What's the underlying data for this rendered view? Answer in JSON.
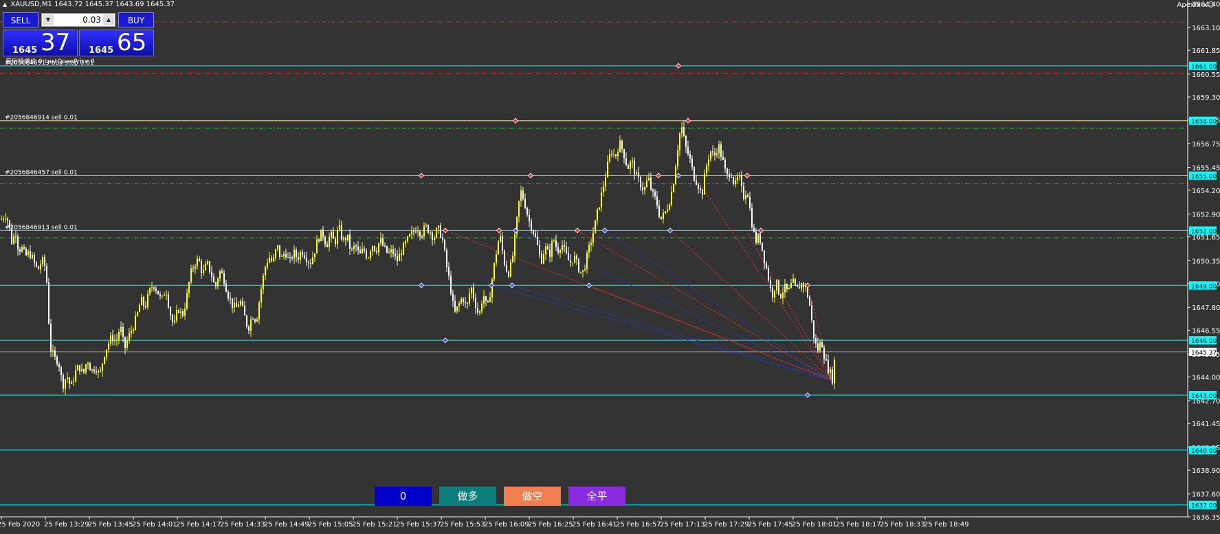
{
  "header": {
    "symbol": "XAUUSD,M1",
    "ohlc": "1643.72 1645.37 1643.69 1645.37",
    "brand": "Apexfx-x☺"
  },
  "trade_panel": {
    "sell_label": "SELL",
    "buy_label": "BUY",
    "lot_value": "0.03",
    "bid_big": "1645",
    "bid_pips": "37",
    "ask_big": "1645",
    "ask_pips": "65",
    "info_text": "最后挂单价 0 LastOpenPrice 0"
  },
  "bottom_buttons": [
    {
      "label": "0",
      "color": "#0000c8"
    },
    {
      "label": "做多",
      "color": "#0b7d7d"
    },
    {
      "label": "做空",
      "color": "#f07f4f"
    },
    {
      "label": "全平",
      "color": "#8a2be2"
    }
  ],
  "chart_data": {
    "type": "candlestick",
    "symbol": "XAUUSD",
    "timeframe": "M1",
    "ylim": [
      1636.35,
      1664.3
    ],
    "y_ticks": [
      "1664.40",
      "1663.10",
      "1661.85",
      "1660.55",
      "1659.30",
      "1658.05",
      "1656.75",
      "1655.45",
      "1654.20",
      "1652.90",
      "1651.65",
      "1650.35",
      "1649.10",
      "1647.80",
      "1646.55",
      "1645.25",
      "1644.00",
      "1642.70",
      "1641.45",
      "1640.15",
      "1638.90",
      "1637.60",
      "1636.35"
    ],
    "x_ticks": [
      "25 Feb 2020",
      "25 Feb 13:29",
      "25 Feb 13:45",
      "25 Feb 14:01",
      "25 Feb 14:17",
      "25 Feb 14:33",
      "25 Feb 14:49",
      "25 Feb 15:05",
      "25 Feb 15:21",
      "25 Feb 15:37",
      "25 Feb 15:53",
      "25 Feb 16:09",
      "25 Feb 16:25",
      "25 Feb 16:41",
      "25 Feb 16:57",
      "25 Feb 17:13",
      "25 Feb 17:29",
      "25 Feb 17:45",
      "25 Feb 18:01",
      "25 Feb 18:17",
      "25 Feb 18:33",
      "25 Feb 18:49"
    ],
    "current_price": "1645.37",
    "horizontal_levels": [
      {
        "price": 1661.0,
        "label": "1661.00",
        "color": "#00ffff"
      },
      {
        "price": 1658.0,
        "label": "1658.00",
        "color": "#ffff00"
      },
      {
        "price": 1655.0,
        "label": "1655.00",
        "color": "#00ffff"
      },
      {
        "price": 1652.0,
        "label": "1652.00",
        "color": "#00ffff"
      },
      {
        "price": 1649.0,
        "label": "1649.00",
        "color": "#00ffff"
      },
      {
        "price": 1646.0,
        "label": "1646.00",
        "color": "#00ffff"
      },
      {
        "price": 1643.0,
        "label": "1643.00",
        "color": "#00ffff"
      },
      {
        "price": 1640.0,
        "label": "1640.00",
        "color": "#00ffff"
      },
      {
        "price": 1637.0,
        "label": "1637.00",
        "color": "#00ffff"
      }
    ],
    "dashed_levels": [
      {
        "price": 1663.4,
        "color": "#c83232"
      },
      {
        "price": 1660.6,
        "color": "#c83232"
      },
      {
        "price": 1657.6,
        "color": "#32b432"
      },
      {
        "price": 1654.55,
        "color": "#32b432"
      },
      {
        "price": 1651.6,
        "color": "#32b432"
      }
    ],
    "order_labels": [
      {
        "price": 1661.0,
        "text": "#2056846913 buy stop 0.01"
      },
      {
        "price": 1658.0,
        "text": "#2056846914 sell 0.01"
      },
      {
        "price": 1655.0,
        "text": "#2056846457 sell 0.01"
      },
      {
        "price": 1652.0,
        "text": "#2056846913 sell 0.01"
      }
    ],
    "close_path": [
      [
        0,
        1652.6
      ],
      [
        8,
        1652.9
      ],
      [
        12,
        1652.3
      ],
      [
        16,
        1651.4
      ],
      [
        22,
        1651.9
      ],
      [
        26,
        1650.9
      ],
      [
        30,
        1651.1
      ],
      [
        36,
        1650.6
      ],
      [
        42,
        1650.8
      ],
      [
        48,
        1650.3
      ],
      [
        54,
        1649.8
      ],
      [
        60,
        1650.4
      ],
      [
        66,
        1649.9
      ],
      [
        72,
        1645.6
      ],
      [
        78,
        1645.0
      ],
      [
        84,
        1644.9
      ],
      [
        90,
        1643.5
      ],
      [
        96,
        1644.1
      ],
      [
        102,
        1643.4
      ],
      [
        108,
        1644.2
      ],
      [
        114,
        1644.6
      ],
      [
        120,
        1644.1
      ],
      [
        126,
        1645.0
      ],
      [
        132,
        1644.3
      ],
      [
        138,
        1644.6
      ],
      [
        144,
        1644.0
      ],
      [
        150,
        1645.2
      ],
      [
        156,
        1645.8
      ],
      [
        162,
        1646.2
      ],
      [
        168,
        1645.9
      ],
      [
        174,
        1646.8
      ],
      [
        180,
        1645.5
      ],
      [
        186,
        1646.2
      ],
      [
        192,
        1646.7
      ],
      [
        198,
        1647.3
      ],
      [
        204,
        1648.2
      ],
      [
        210,
        1647.8
      ],
      [
        216,
        1648.6
      ],
      [
        222,
        1649.1
      ],
      [
        228,
        1648.7
      ],
      [
        234,
        1648.1
      ],
      [
        240,
        1648.9
      ],
      [
        246,
        1647.6
      ],
      [
        252,
        1646.7
      ],
      [
        258,
        1647.8
      ],
      [
        264,
        1647.3
      ],
      [
        270,
        1648.2
      ],
      [
        276,
        1649.6
      ],
      [
        282,
        1650.2
      ],
      [
        288,
        1650.4
      ],
      [
        294,
        1649.6
      ],
      [
        300,
        1650.2
      ],
      [
        306,
        1649.7
      ],
      [
        312,
        1648.8
      ],
      [
        318,
        1649.8
      ],
      [
        324,
        1649.5
      ],
      [
        330,
        1648.6
      ],
      [
        336,
        1648.0
      ],
      [
        342,
        1647.7
      ],
      [
        348,
        1648.2
      ],
      [
        354,
        1647.4
      ],
      [
        360,
        1646.6
      ],
      [
        366,
        1647.4
      ],
      [
        372,
        1647.1
      ],
      [
        378,
        1648.6
      ],
      [
        384,
        1649.9
      ],
      [
        390,
        1650.6
      ],
      [
        396,
        1650.2
      ],
      [
        402,
        1651.2
      ],
      [
        408,
        1650.4
      ],
      [
        414,
        1650.9
      ],
      [
        420,
        1650.2
      ],
      [
        426,
        1650.8
      ],
      [
        432,
        1650.5
      ],
      [
        438,
        1650.9
      ],
      [
        444,
        1650.6
      ],
      [
        450,
        1650.2
      ],
      [
        456,
        1650.8
      ],
      [
        462,
        1651.6
      ],
      [
        468,
        1651.9
      ],
      [
        474,
        1651.2
      ],
      [
        480,
        1651.8
      ],
      [
        486,
        1651.3
      ],
      [
        492,
        1652.2
      ],
      [
        498,
        1651.4
      ],
      [
        504,
        1651.7
      ],
      [
        510,
        1650.8
      ],
      [
        516,
        1651.2
      ],
      [
        522,
        1650.6
      ],
      [
        528,
        1651.0
      ],
      [
        534,
        1650.5
      ],
      [
        540,
        1651.3
      ],
      [
        546,
        1650.9
      ],
      [
        552,
        1651.5
      ],
      [
        558,
        1651.0
      ],
      [
        564,
        1650.7
      ],
      [
        570,
        1650.9
      ],
      [
        576,
        1650.3
      ],
      [
        582,
        1650.8
      ],
      [
        588,
        1651.2
      ],
      [
        594,
        1651.6
      ],
      [
        600,
        1651.9
      ],
      [
        606,
        1652.2
      ],
      [
        612,
        1651.8
      ],
      [
        618,
        1652.2
      ],
      [
        624,
        1652.0
      ],
      [
        630,
        1651.6
      ],
      [
        636,
        1652.1
      ],
      [
        642,
        1651.7
      ],
      [
        648,
        1650.2
      ],
      [
        654,
        1649.0
      ],
      [
        660,
        1647.4
      ],
      [
        666,
        1647.9
      ],
      [
        672,
        1648.4
      ],
      [
        678,
        1647.7
      ],
      [
        684,
        1649.0
      ],
      [
        690,
        1648.1
      ],
      [
        696,
        1647.3
      ],
      [
        702,
        1648.6
      ],
      [
        708,
        1647.6
      ],
      [
        714,
        1649.1
      ],
      [
        720,
        1650.6
      ],
      [
        726,
        1651.8
      ],
      [
        732,
        1650.4
      ],
      [
        738,
        1649.6
      ],
      [
        744,
        1650.3
      ],
      [
        750,
        1652.2
      ],
      [
        756,
        1654.2
      ],
      [
        762,
        1653.6
      ],
      [
        768,
        1652.6
      ],
      [
        774,
        1652.1
      ],
      [
        780,
        1651.3
      ],
      [
        786,
        1650.3
      ],
      [
        792,
        1651.1
      ],
      [
        798,
        1650.6
      ],
      [
        804,
        1651.6
      ],
      [
        810,
        1650.9
      ],
      [
        816,
        1651.3
      ],
      [
        822,
        1650.7
      ],
      [
        828,
        1650.2
      ],
      [
        834,
        1650.6
      ],
      [
        840,
        1650.0
      ],
      [
        846,
        1649.6
      ],
      [
        852,
        1650.4
      ],
      [
        858,
        1651.3
      ],
      [
        864,
        1652.2
      ],
      [
        870,
        1653.3
      ],
      [
        876,
        1654.3
      ],
      [
        882,
        1655.4
      ],
      [
        888,
        1656.4
      ],
      [
        894,
        1656.0
      ],
      [
        900,
        1656.8
      ],
      [
        906,
        1656.3
      ],
      [
        912,
        1655.4
      ],
      [
        918,
        1655.8
      ],
      [
        924,
        1655.0
      ],
      [
        930,
        1654.6
      ],
      [
        936,
        1654.2
      ],
      [
        942,
        1654.9
      ],
      [
        948,
        1654.0
      ],
      [
        954,
        1653.6
      ],
      [
        960,
        1652.6
      ],
      [
        966,
        1652.9
      ],
      [
        972,
        1653.5
      ],
      [
        978,
        1654.4
      ],
      [
        984,
        1656.3
      ],
      [
        990,
        1657.8
      ],
      [
        996,
        1656.6
      ],
      [
        1002,
        1656.0
      ],
      [
        1008,
        1655.0
      ],
      [
        1014,
        1654.6
      ],
      [
        1020,
        1653.9
      ],
      [
        1026,
        1655.4
      ],
      [
        1032,
        1656.4
      ],
      [
        1038,
        1656.0
      ],
      [
        1044,
        1656.7
      ],
      [
        1050,
        1655.9
      ],
      [
        1056,
        1654.9
      ],
      [
        1062,
        1655.3
      ],
      [
        1068,
        1654.4
      ],
      [
        1074,
        1655.0
      ],
      [
        1080,
        1653.8
      ],
      [
        1086,
        1654.3
      ],
      [
        1092,
        1652.6
      ],
      [
        1098,
        1651.4
      ],
      [
        1104,
        1651.7
      ],
      [
        1110,
        1650.6
      ],
      [
        1116,
        1649.6
      ],
      [
        1122,
        1648.4
      ],
      [
        1128,
        1649.2
      ],
      [
        1134,
        1648.4
      ],
      [
        1140,
        1648.9
      ],
      [
        1146,
        1648.6
      ],
      [
        1152,
        1649.2
      ],
      [
        1158,
        1648.7
      ],
      [
        1164,
        1649.1
      ],
      [
        1170,
        1649.0
      ],
      [
        1176,
        1648.2
      ],
      [
        1182,
        1646.4
      ],
      [
        1188,
        1645.4
      ],
      [
        1194,
        1646.0
      ],
      [
        1200,
        1644.8
      ],
      [
        1206,
        1644.3
      ],
      [
        1211,
        1643.8
      ],
      [
        1214,
        1645.37
      ]
    ],
    "line_segments": [
      {
        "x1": 648,
        "y1": 1652.0,
        "x2": 1211,
        "y2": 1643.8,
        "color": "#c83232"
      },
      {
        "x1": 750,
        "y1": 1652.0,
        "x2": 1211,
        "y2": 1643.8,
        "color": "#2040c8"
      },
      {
        "x1": 840,
        "y1": 1652.0,
        "x2": 1211,
        "y2": 1643.8,
        "color": "#c83232"
      },
      {
        "x1": 880,
        "y1": 1652.0,
        "x2": 1211,
        "y2": 1643.8,
        "color": "#2040c8"
      },
      {
        "x1": 975,
        "y1": 1652.0,
        "x2": 1211,
        "y2": 1643.8,
        "color": "#c83232"
      },
      {
        "x1": 1010,
        "y1": 1655.0,
        "x2": 1211,
        "y2": 1643.8,
        "color": "#c83232"
      },
      {
        "x1": 1085,
        "y1": 1652.0,
        "x2": 1211,
        "y2": 1643.8,
        "color": "#c83232"
      },
      {
        "x1": 1175,
        "y1": 1649.0,
        "x2": 1211,
        "y2": 1643.8,
        "color": "#c83232"
      },
      {
        "x1": 715,
        "y1": 1649.0,
        "x2": 1211,
        "y2": 1643.8,
        "color": "#2040c8"
      },
      {
        "x1": 745,
        "y1": 1649.0,
        "x2": 1211,
        "y2": 1643.8,
        "color": "#2040c8"
      },
      {
        "x1": 857,
        "y1": 1649.0,
        "x2": 1211,
        "y2": 1643.8,
        "color": "#c83232"
      }
    ],
    "markers": [
      {
        "x": 987,
        "y": 1661.0,
        "color": "#e83030"
      },
      {
        "x": 750,
        "y": 1658.0,
        "color": "#e83030"
      },
      {
        "x": 1001,
        "y": 1658.0,
        "color": "#e83030"
      },
      {
        "x": 613,
        "y": 1655.0,
        "color": "#e83030"
      },
      {
        "x": 772,
        "y": 1655.0,
        "color": "#e83030"
      },
      {
        "x": 958,
        "y": 1655.0,
        "color": "#e83030"
      },
      {
        "x": 1087,
        "y": 1655.0,
        "color": "#e83030"
      },
      {
        "x": 987,
        "y": 1655.0,
        "color": "#3a5af0"
      },
      {
        "x": 648,
        "y": 1652.0,
        "color": "#e83030"
      },
      {
        "x": 726,
        "y": 1652.0,
        "color": "#e83030"
      },
      {
        "x": 750,
        "y": 1652.0,
        "color": "#3a5af0"
      },
      {
        "x": 840,
        "y": 1652.0,
        "color": "#e83030"
      },
      {
        "x": 880,
        "y": 1652.0,
        "color": "#3a5af0"
      },
      {
        "x": 975,
        "y": 1652.0,
        "color": "#3a5af0"
      },
      {
        "x": 1107,
        "y": 1652.0,
        "color": "#e83030"
      },
      {
        "x": 613,
        "y": 1649.0,
        "color": "#3a5af0"
      },
      {
        "x": 715,
        "y": 1649.0,
        "color": "#3a5af0"
      },
      {
        "x": 745,
        "y": 1649.0,
        "color": "#3a5af0"
      },
      {
        "x": 857,
        "y": 1649.0,
        "color": "#3a5af0"
      },
      {
        "x": 1175,
        "y": 1649.0,
        "color": "#e83030"
      },
      {
        "x": 648,
        "y": 1646.0,
        "color": "#3a5af0"
      },
      {
        "x": 1175,
        "y": 1643.0,
        "color": "#3a5af0"
      }
    ],
    "colors": {
      "background": "#333333",
      "bull_candle": "#ffff00",
      "bear_candle": "#ffffff",
      "axis_text": "#ffffff",
      "level_label_bg": "#00ffff"
    }
  }
}
